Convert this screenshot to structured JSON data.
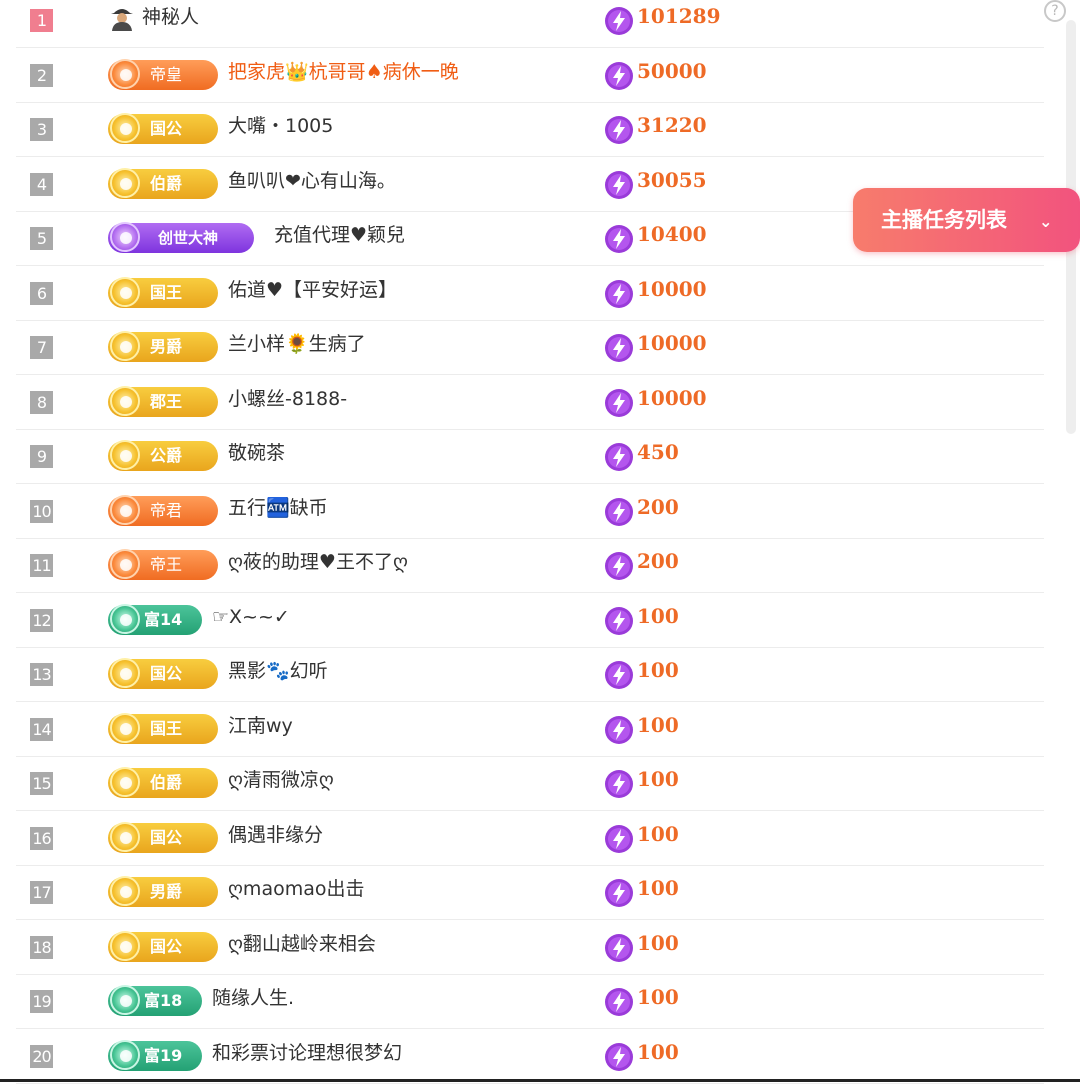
{
  "help_icon": "?",
  "task_button": {
    "label": "主播任务列表",
    "chevron": "⌄"
  },
  "colors": {
    "amount": "#ee6a26",
    "highlight_name": "#f05d14",
    "task_button_start": "#f77c6c",
    "task_button_end": "#f2537e",
    "rank_top": "#f07e8f",
    "rank_default": "#a9a9a9"
  },
  "rows": [
    {
      "rank": "1",
      "avatar_icon": "spy-icon",
      "badge": null,
      "name": "神秘人",
      "amount": "101289"
    },
    {
      "rank": "2",
      "badge": {
        "style": "orange",
        "label": "帝皇"
      },
      "name": "把家虎👑杭哥哥♠病休一晚",
      "highlight": true,
      "amount": "50000"
    },
    {
      "rank": "3",
      "badge": {
        "style": "gold",
        "label": "国公"
      },
      "name": "大嘴・1005",
      "amount": "31220"
    },
    {
      "rank": "4",
      "badge": {
        "style": "gold",
        "label": "伯爵"
      },
      "name": "鱼叭叭❤心有山海。",
      "amount": "30055"
    },
    {
      "rank": "5",
      "badge": {
        "style": "purple",
        "label": "创世大神"
      },
      "name": "充值代理♥颖兒",
      "amount": "10400"
    },
    {
      "rank": "6",
      "badge": {
        "style": "gold",
        "label": "国王"
      },
      "name": "佑道♥【平安好运】",
      "amount": "10000"
    },
    {
      "rank": "7",
      "badge": {
        "style": "gold",
        "label": "男爵"
      },
      "name": "兰小样🌻生病了",
      "amount": "10000"
    },
    {
      "rank": "8",
      "badge": {
        "style": "gold",
        "label": "郡王"
      },
      "name": "小螺丝-8188-",
      "amount": "10000"
    },
    {
      "rank": "9",
      "badge": {
        "style": "gold",
        "label": "公爵"
      },
      "name": "敬碗茶",
      "amount": "450"
    },
    {
      "rank": "10",
      "badge": {
        "style": "orange",
        "label": "帝君"
      },
      "name": "五行🏧缺币",
      "amount": "200"
    },
    {
      "rank": "11",
      "badge": {
        "style": "orange",
        "label": "帝王"
      },
      "name": "ღ莜的助理♥王不了ღ",
      "amount": "200"
    },
    {
      "rank": "12",
      "badge": {
        "style": "teal",
        "label": "富14"
      },
      "name": "☞X~~✓",
      "amount": "100"
    },
    {
      "rank": "13",
      "badge": {
        "style": "gold",
        "label": "国公"
      },
      "name": "黑影🐾幻听",
      "amount": "100"
    },
    {
      "rank": "14",
      "badge": {
        "style": "gold",
        "label": "国王"
      },
      "name": "江南wy",
      "amount": "100"
    },
    {
      "rank": "15",
      "badge": {
        "style": "gold",
        "label": "伯爵"
      },
      "name": "ღ清雨微凉ღ",
      "amount": "100"
    },
    {
      "rank": "16",
      "badge": {
        "style": "gold",
        "label": "国公"
      },
      "name": "偶遇非缘分",
      "amount": "100"
    },
    {
      "rank": "17",
      "badge": {
        "style": "gold",
        "label": "男爵"
      },
      "name": "ღmaomao出击",
      "amount": "100"
    },
    {
      "rank": "18",
      "badge": {
        "style": "gold",
        "label": "国公"
      },
      "name": "ღ翻山越岭来相会",
      "amount": "100"
    },
    {
      "rank": "19",
      "badge": {
        "style": "teal",
        "label": "富18"
      },
      "name": "随缘人生.",
      "amount": "100"
    },
    {
      "rank": "20",
      "badge": {
        "style": "teal",
        "label": "富19"
      },
      "name": "和彩票讨论理想很梦幻",
      "amount": "100"
    }
  ]
}
